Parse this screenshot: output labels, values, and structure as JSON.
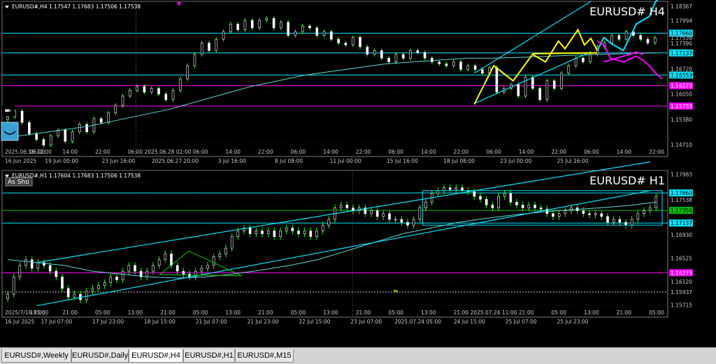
{
  "colors": {
    "cyan": "#00e5ff",
    "mag": "#ff00ff",
    "yellow": "#ffff00",
    "green": "#00c000",
    "grid": "#3a3a3a",
    "axis": "#c8c8c8"
  },
  "tabs": [
    {
      "label": "EURUSD#,Weekly",
      "active": false
    },
    {
      "label": "EURUSD#,Daily",
      "active": false
    },
    {
      "label": "EURUSD#,H4",
      "active": true
    },
    {
      "label": "EURUSD#,H1",
      "active": false
    },
    {
      "label": "EURUSD#,M15",
      "active": false
    }
  ],
  "chart_data": [
    {
      "type": "candlestick",
      "header": "EURUSD#,H4  1.17547 1.17683 1.17506 1.17538",
      "watermark": "EURUSD# H4",
      "ylim": [
        1.144,
        1.185
      ],
      "y_ticks": [
        "1.18367",
        "1.17994",
        "1.17660",
        "1.17538",
        "1.17390",
        "1.17137",
        "1.16720",
        "1.16553",
        "1.16273",
        "1.16050",
        "1.15733",
        "1.15380",
        "1.14710"
      ],
      "x_ticks": [
        "16 Jun 2025",
        "19 Jun 00:00",
        "23 Jun 16:00",
        "2025.06.27 20:00",
        "3 Jul 16:00",
        "8 Jul 08:00",
        "11 Jul 00:00",
        "15 Jul 16:00",
        "18 Jul 08:00",
        "23 Jul 00:00",
        "25 Jul 16:00"
      ],
      "x_ticks_top": [
        "2025.06.16 22:00",
        "06:00",
        "14:00",
        "22:00",
        "06:00",
        "2025.06.28 02:00",
        "06:00",
        "14:00",
        "22:00",
        "06:00",
        "14:00",
        "22:00",
        "06:00",
        "14:00",
        "22:00",
        "06:00",
        "14:00",
        "22:00",
        "06:00",
        "14:00",
        "22:00"
      ],
      "levels": [
        {
          "value": 1.1766,
          "label": "1.17660",
          "color": "cyan"
        },
        {
          "value": 1.17137,
          "label": "1.17137",
          "color": "cyan"
        },
        {
          "value": 1.16553,
          "label": "1.16553",
          "color": "cyan"
        },
        {
          "value": 1.16273,
          "label": "1.16273",
          "color": "mag"
        },
        {
          "value": 1.15733,
          "label": "1.15733",
          "color": "mag"
        }
      ],
      "closes": [
        1.1545,
        1.156,
        1.153,
        1.15,
        1.1485,
        1.147,
        1.1495,
        1.151,
        1.148,
        1.1505,
        1.1525,
        1.1505,
        1.154,
        1.153,
        1.1555,
        1.1575,
        1.16,
        1.1615,
        1.1625,
        1.161,
        1.162,
        1.1605,
        1.159,
        1.1615,
        1.1645,
        1.168,
        1.171,
        1.174,
        1.172,
        1.175,
        1.177,
        1.179,
        1.1775,
        1.18,
        1.178,
        1.18,
        1.1805,
        1.178,
        1.1795,
        1.176,
        1.177,
        1.1785,
        1.178,
        1.176,
        1.177,
        1.175,
        1.174,
        1.1735,
        1.1755,
        1.173,
        1.171,
        1.172,
        1.17,
        1.169,
        1.171,
        1.17,
        1.172,
        1.1715,
        1.17,
        1.169,
        1.1685,
        1.168,
        1.169,
        1.167,
        1.168,
        1.167,
        1.166,
        1.1675,
        1.161,
        1.162,
        1.163,
        1.16,
        1.165,
        1.162,
        1.159,
        1.164,
        1.162,
        1.166,
        1.168,
        1.17,
        1.169,
        1.171,
        1.173,
        1.174,
        1.176,
        1.175,
        1.177,
        1.176,
        1.175,
        1.174,
        1.1754
      ],
      "sma": [
        1.149,
        1.15,
        1.151,
        1.152,
        1.1535,
        1.155,
        1.1565,
        1.1585,
        1.1605,
        1.1625,
        1.164,
        1.1655,
        1.1665,
        1.1675,
        1.1685,
        1.169,
        1.1695,
        1.17,
        1.17,
        1.1702,
        1.1705,
        1.1708,
        1.171,
        1.1712,
        1.1714
      ],
      "channel": {
        "lower": [
          [
            72,
            1.158
          ],
          [
            90,
            1.1717
          ]
        ],
        "upper": [
          [
            72,
            1.166
          ],
          [
            90,
            1.185
          ]
        ]
      },
      "pattern": [
        [
          72,
          1.1578
        ],
        [
          75,
          1.168
        ],
        [
          78,
          1.164
        ],
        [
          81,
          1.171
        ],
        [
          83,
          1.169
        ],
        [
          85,
          1.1745
        ],
        [
          86,
          1.1725
        ],
        [
          88,
          1.1775
        ],
        [
          89,
          1.1735
        ],
        [
          90,
          1.1752
        ],
        [
          91,
          1.172
        ]
      ],
      "neckline": [
        [
          81,
          1.1712
        ],
        [
          91,
          1.1714
        ]
      ],
      "proj_cyan": [
        [
          91,
          1.172
        ],
        [
          92,
          1.1755
        ],
        [
          93,
          1.174
        ],
        [
          95,
          1.172
        ],
        [
          97,
          1.179
        ],
        [
          99,
          1.181
        ],
        [
          100,
          1.185
        ],
        [
          101,
          1.1865
        ]
      ],
      "proj_mag": [
        [
          91,
          1.1745
        ],
        [
          92,
          1.1735
        ],
        [
          93,
          1.17
        ],
        [
          95,
          1.169
        ],
        [
          97,
          1.1705
        ],
        [
          98,
          1.1695
        ],
        [
          99,
          1.168
        ],
        [
          100,
          1.166
        ],
        [
          101,
          1.1645
        ]
      ],
      "proj_mag2": [
        [
          92,
          1.169
        ],
        [
          94,
          1.17
        ],
        [
          96,
          1.171
        ],
        [
          97,
          1.1716
        ],
        [
          98,
          1.171
        ]
      ]
    },
    {
      "type": "candlestick",
      "header": "EURUSD#,H1  1.17604 1.17683 1.17506 1.17538",
      "watermark": "EURUSD# H1",
      "label_button": "As Sho",
      "ylim": [
        1.155,
        1.1805
      ],
      "y_ticks": [
        "1.17983",
        "1.17660",
        "1.17538",
        "1.17356",
        "1.17137",
        "1.16930",
        "1.16525",
        "1.16273",
        "1.16120",
        "1.15937",
        "1.15715"
      ],
      "x_ticks": [
        "16 Jul 2025",
        "17 Jul 07:00",
        "17 Jul 23:00",
        "18 Jul 15:00",
        "21 Jul 07:00",
        "21 Jul 23:00",
        "22 Jul 15:00",
        "23 Jul 07:00",
        "2025.07.24 05:00",
        "24 Jul 15:00",
        "25 Jul 07:00",
        "25 Jul 23:00"
      ],
      "x_ticks_top": [
        "2025/7/16 05:00",
        "13:00",
        "21:00",
        "05:00",
        "13:00",
        "21:00",
        "05:00",
        "13:00",
        "21:00",
        "05:00",
        "13:00",
        "21:00",
        "05:00",
        "13:00",
        "21:00",
        "2025.07.24 11:00",
        "21:00",
        "05:00",
        "13:00",
        "21:00",
        "05:00"
      ],
      "levels": [
        {
          "value": 1.1766,
          "label": "1.17660",
          "color": "cyan"
        },
        {
          "value": 1.17356,
          "label": "1.17356",
          "color": "green"
        },
        {
          "value": 1.17137,
          "label": "1.17137",
          "color": "cyan"
        },
        {
          "value": 1.16273,
          "label": "1.16273",
          "color": "mag"
        },
        {
          "value": 1.15937,
          "label": "1.15937",
          "color": "dot"
        }
      ],
      "closes": [
        1.159,
        1.162,
        1.164,
        1.165,
        1.1635,
        1.1645,
        1.164,
        1.163,
        1.162,
        1.16,
        1.1585,
        1.159,
        1.158,
        1.1595,
        1.16,
        1.1605,
        1.161,
        1.162,
        1.1615,
        1.163,
        1.164,
        1.163,
        1.162,
        1.163,
        1.164,
        1.165,
        1.166,
        1.164,
        1.163,
        1.1625,
        1.162,
        1.163,
        1.1635,
        1.164,
        1.1655,
        1.166,
        1.167,
        1.169,
        1.17,
        1.1705,
        1.1695,
        1.17,
        1.1695,
        1.17,
        1.169,
        1.17,
        1.1705,
        1.17,
        1.1695,
        1.17,
        1.169,
        1.17,
        1.171,
        1.172,
        1.174,
        1.1745,
        1.174,
        1.1735,
        1.174,
        1.173,
        1.1735,
        1.1725,
        1.173,
        1.172,
        1.172,
        1.1715,
        1.171,
        1.172,
        1.174,
        1.175,
        1.1765,
        1.177,
        1.1775,
        1.1772,
        1.1775,
        1.177,
        1.1768,
        1.176,
        1.1755,
        1.1745,
        1.174,
        1.176,
        1.1765,
        1.175,
        1.1745,
        1.174,
        1.1745,
        1.174,
        1.1738,
        1.173,
        1.1725,
        1.173,
        1.1735,
        1.174,
        1.1735,
        1.173,
        1.1728,
        1.173,
        1.1725,
        1.1715,
        1.172,
        1.1715,
        1.171,
        1.172,
        1.173,
        1.1735,
        1.174,
        1.176
      ],
      "ma": [
        1.165,
        1.1645,
        1.164,
        1.163,
        1.1625,
        1.162,
        1.1618,
        1.162,
        1.1625,
        1.1632,
        1.164,
        1.165,
        1.1665,
        1.168,
        1.1695,
        1.1705,
        1.1715,
        1.1722,
        1.1728,
        1.1733,
        1.1737,
        1.174,
        1.1744,
        1.175
      ],
      "channel": {
        "lower": [
          [
            5,
            1.157
          ],
          [
            110,
            1.177
          ]
        ],
        "upper": [
          [
            5,
            1.1645
          ],
          [
            110,
            1.182
          ]
        ]
      },
      "triangle": [
        [
          31,
          1.1665
        ],
        [
          40,
          1.1622
        ],
        [
          26,
          1.1624
        ]
      ],
      "box": {
        "x0": 71,
        "x1": 112,
        "y0": 1.177,
        "y1": 1.171
      }
    }
  ]
}
